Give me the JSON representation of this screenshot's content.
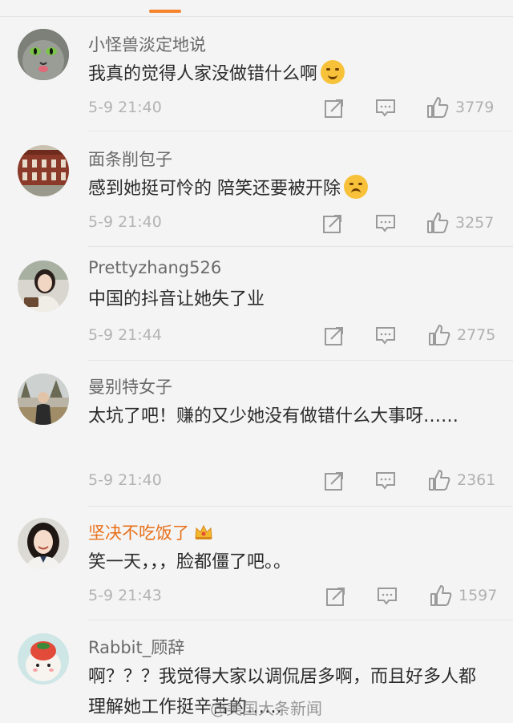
{
  "colors": {
    "accent": "#f5842c",
    "vip_name": "#e8701a",
    "text": "#2b2b2b",
    "meta": "#b3b3b3"
  },
  "comments": [
    {
      "username": "小怪兽淡定地说",
      "text": "我真的觉得人家没做错什么啊",
      "emoji": "laughing-crying-emoji",
      "time": "5-9 21:40",
      "likes": "3779",
      "avatar_icon": "cat-avatar-icon",
      "vip": false
    },
    {
      "username": "面条削包子",
      "text": "感到她挺可怜的 陪笑还要被开除",
      "emoji": "sad-sweat-emoji",
      "time": "5-9 21:40",
      "likes": "3257",
      "avatar_icon": "building-avatar-icon",
      "vip": false
    },
    {
      "username": "Prettyzhang526",
      "text": "中国的抖音让她失了业",
      "time": "5-9 21:44",
      "likes": "2775",
      "avatar_icon": "girl-avatar-icon",
      "vip": false
    },
    {
      "username": "曼别特女子",
      "text": "太坑了吧！赚的又少她没有做错什么大事呀……",
      "time": "5-9 21:40",
      "likes": "2361",
      "avatar_icon": "man-outdoor-avatar-icon",
      "vip": false
    },
    {
      "username": "坚决不吃饭了",
      "text": "笑一天，，，脸都僵了吧。。",
      "time": "5-9 21:43",
      "likes": "1597",
      "avatar_icon": "smiling-girl-avatar-icon",
      "vip": true,
      "badge": "crown-icon"
    },
    {
      "username": "Rabbit_顾辞",
      "text": "啊？？？我觉得大家以调侃居多啊，而且好多人都理解她工作挺辛苦的……",
      "avatar_icon": "cartoon-avatar-icon",
      "vip": false
    }
  ],
  "watermark": "@美国大条新闻"
}
